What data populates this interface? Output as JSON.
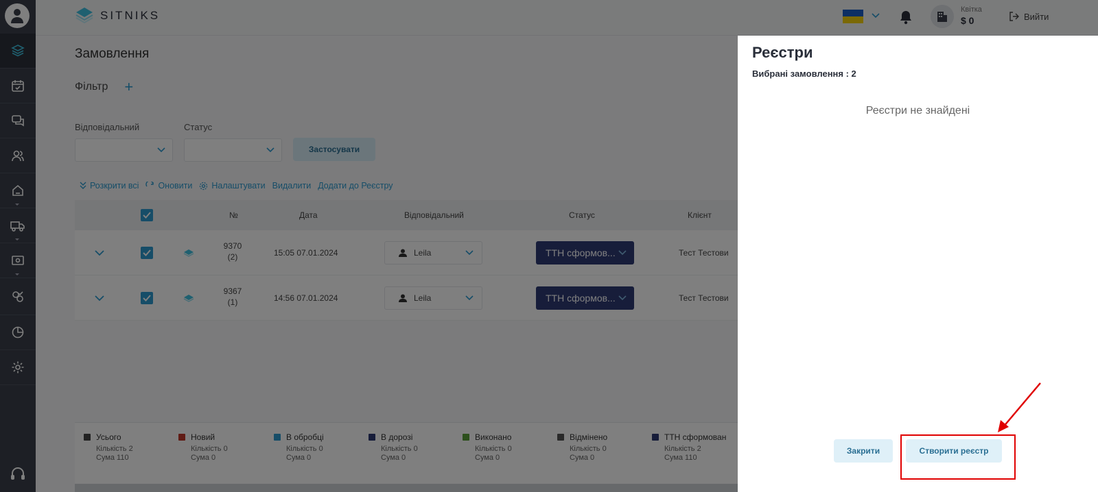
{
  "header": {
    "brand": "SITNIKS",
    "plan_name": "Квітка",
    "balance": "$ 0",
    "logout_label": "Вийти"
  },
  "page": {
    "title": "Замовлення",
    "filter_label": "Фільтр",
    "filter_add": "+",
    "responsible_label": "Відповідальний",
    "status_label": "Статус",
    "apply_label": "Застосувати"
  },
  "toolbar": {
    "expand_all": "Розкрити всі",
    "refresh": "Оновити",
    "settings": "Налаштувати",
    "delete": "Видалити",
    "add_to_registry": "Додати до Реєстру"
  },
  "table": {
    "columns": {
      "number": "№",
      "date": "Дата",
      "responsible": "Відповідальний",
      "status": "Статус",
      "client": "Клієнт"
    },
    "rows": [
      {
        "number": "9370",
        "count": "(2)",
        "date": "15:05 07.01.2024",
        "responsible": "Leila",
        "status": "ТТН сформов...",
        "client": "Тест Тестови"
      },
      {
        "number": "9367",
        "count": "(1)",
        "date": "14:56 07.01.2024",
        "responsible": "Leila",
        "status": "ТТН сформов...",
        "client": "Тест Тестови"
      }
    ]
  },
  "legend": [
    {
      "label": "Усього",
      "qty": "Кількість 2",
      "sum": "Сума 110",
      "color": "#444444"
    },
    {
      "label": "Новий",
      "qty": "Кількість 0",
      "sum": "Сума 0",
      "color": "#c0392b"
    },
    {
      "label": "В обробці",
      "qty": "Кількість 0",
      "sum": "Сума 0",
      "color": "#2c9bd1"
    },
    {
      "label": "В дорозі",
      "qty": "Кількість 0",
      "sum": "Сума 0",
      "color": "#2e3a75"
    },
    {
      "label": "Виконано",
      "qty": "Кількість 0",
      "sum": "Сума 0",
      "color": "#5aa03a"
    },
    {
      "label": "Відмінено",
      "qty": "Кількість 0",
      "sum": "Сума 0",
      "color": "#555555"
    },
    {
      "label": "ТТН сформован",
      "qty": "Кількість 2",
      "sum": "Сума 110",
      "color": "#2e3a75"
    }
  ],
  "drawer": {
    "title": "Реєстри",
    "selected_orders": "Вибрані замовлення : 2",
    "empty_message": "Реєстри не знайдені",
    "close_label": "Закрити",
    "create_label": "Створити реєстр"
  },
  "colors": {
    "accent": "#2c9bd1",
    "sidebar": "#3a3f4b",
    "status_pill": "#2e3a75",
    "annotation": "#e00000"
  }
}
